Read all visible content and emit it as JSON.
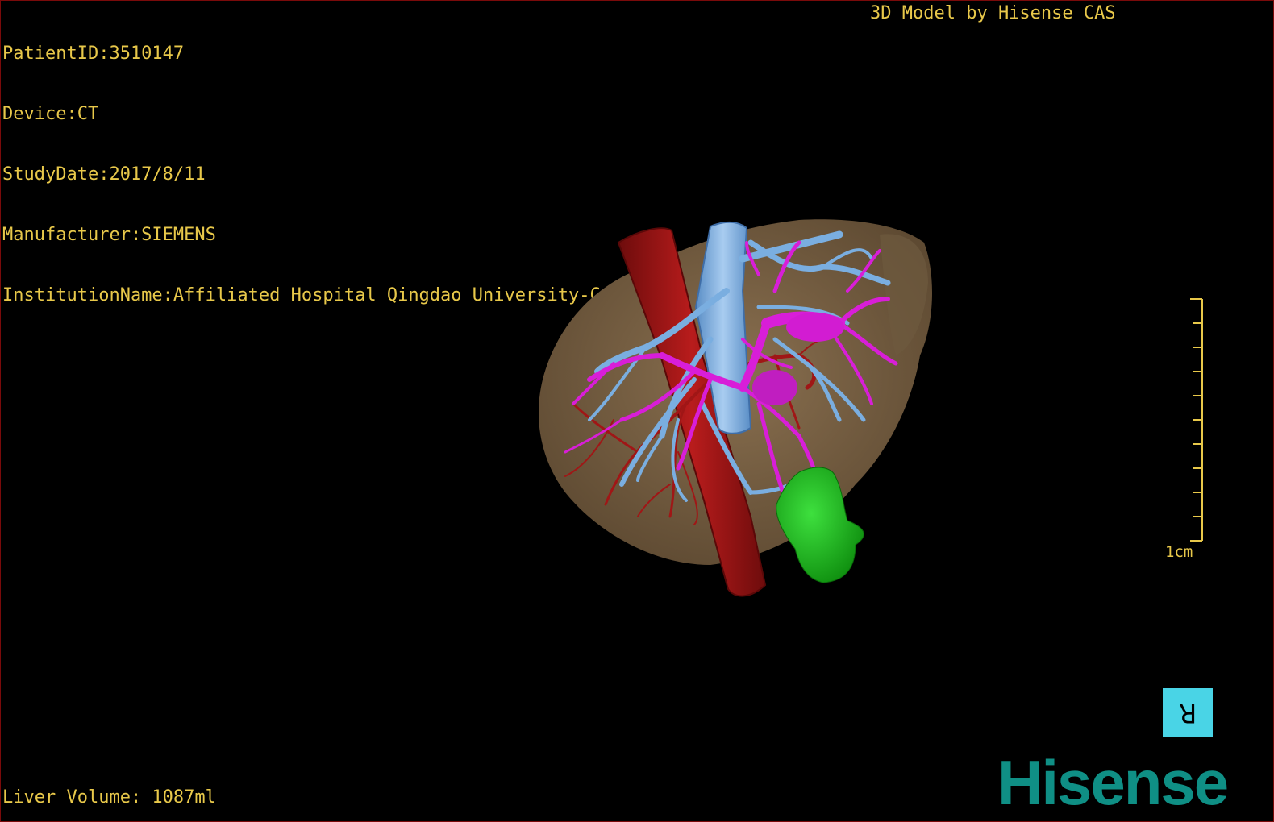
{
  "info": {
    "patient": "PatientID:3510147",
    "device": "Device:CT",
    "study_date": "StudyDate:2017/8/11",
    "manufacturer": "Manufacturer:SIEMENS",
    "institution": "InstitutionName:Affiliated Hospital Qingdao University-C"
  },
  "credit": "3D Model by Hisense CAS",
  "volume": "Liver Volume: 1087ml",
  "scale_label": "1cm",
  "orientation_glyph": "R",
  "logo": "Hisense",
  "model": {
    "structures": [
      "liver-parenchyma",
      "inferior-vena-cava",
      "hepatic-vein-branches",
      "portal-vein-branches",
      "hepatic-artery",
      "lesion"
    ]
  },
  "colors": {
    "overlay_text": "#e8c84a",
    "liver": "#7a6446",
    "ivc": "#9b1414",
    "hepatic_veins": "#7aaee0",
    "portal_veins": "#d81ed8",
    "lesion": "#16b016",
    "orientation_button": "#49d4e6",
    "logo": "#0f8f85"
  }
}
